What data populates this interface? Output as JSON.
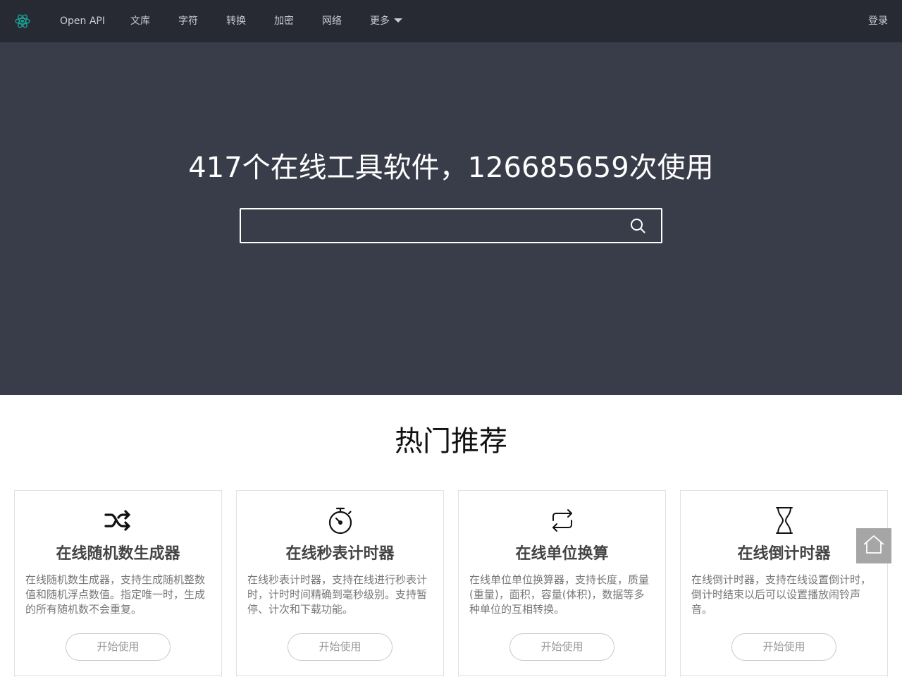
{
  "nav": {
    "items": [
      {
        "label": "Open API"
      },
      {
        "label": "文库"
      },
      {
        "label": "字符"
      },
      {
        "label": "转换"
      },
      {
        "label": "加密"
      },
      {
        "label": "网络"
      },
      {
        "label": "更多"
      }
    ],
    "login": "登录",
    "logo_icon": "atom-logo-icon",
    "logo_color": "#1aa094"
  },
  "hero": {
    "title": "417个在线工具软件，126685659次使用",
    "search_placeholder": "",
    "search_icon": "search-icon"
  },
  "section": {
    "title": "热门推荐"
  },
  "cards": [
    {
      "icon": "shuffle-icon",
      "title": "在线随机数生成器",
      "desc": "在线随机数生成器，支持生成随机整数值和随机浮点数值。指定唯一时，生成的所有随机数不会重复。",
      "button": "开始使用"
    },
    {
      "icon": "stopwatch-icon",
      "title": "在线秒表计时器",
      "desc": "在线秒表计时器，支持在线进行秒表计时，计时时间精确到毫秒级别。支持暂停、计次和下载功能。",
      "button": "开始使用"
    },
    {
      "icon": "repeat-icon",
      "title": "在线单位换算",
      "desc": "在线单位单位换算器，支持长度，质量(重量)，面积，容量(体积)，数据等多种单位的互相转换。",
      "button": "开始使用"
    },
    {
      "icon": "hourglass-icon",
      "title": "在线倒计时器",
      "desc": "在线倒计时器，支持在线设置倒计时，倒计时结束以后可以设置播放闹铃声音。",
      "button": "开始使用"
    }
  ],
  "floating": {
    "home_icon": "home-icon"
  }
}
